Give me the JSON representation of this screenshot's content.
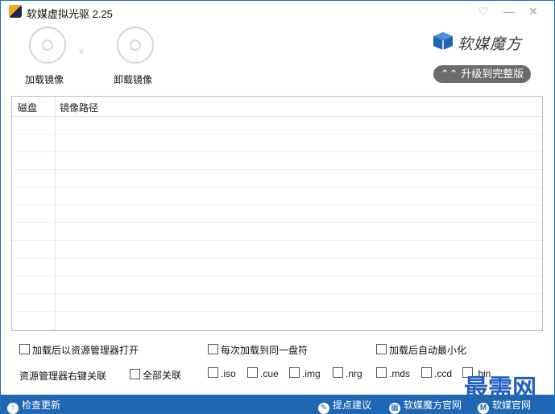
{
  "window": {
    "title": "软媒虚拟光驱 2.25"
  },
  "toolbar": {
    "mount_label": "加载镜像",
    "unmount_label": "卸载镜像"
  },
  "brand": {
    "name": "软媒魔方",
    "upgrade_label": "升级到完整版"
  },
  "table": {
    "columns": [
      "磁盘",
      "镜像路径"
    ],
    "rows": []
  },
  "options": {
    "open_explorer": "加载后以资源管理器打开",
    "same_drive": "每次加载到同一盘符",
    "auto_minimize": "加载后自动最小化"
  },
  "assoc": {
    "label": "资源管理器右键关联",
    "all_label": "全部关联",
    "extensions": [
      ".iso",
      ".cue",
      ".img",
      ".nrg",
      ".mds",
      ".ccd",
      ".bin"
    ]
  },
  "status": {
    "check_update": "检查更新",
    "feedback": "提点建议",
    "mofang_site": "软媒魔方官网",
    "ruanmei_site": "软媒官网"
  },
  "watermark": "最需网",
  "colors": {
    "accent": "#1f66b3",
    "upgrade_bg": "#6b6b6b"
  }
}
